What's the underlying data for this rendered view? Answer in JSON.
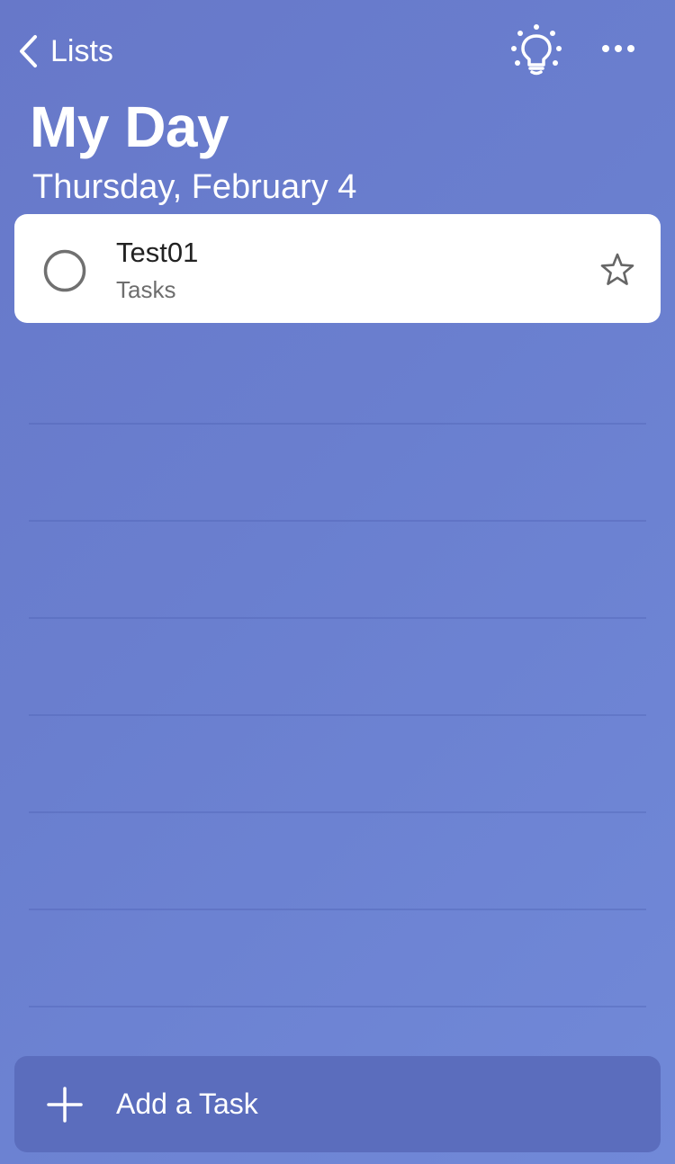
{
  "header": {
    "back_label": "Lists",
    "title": "My Day",
    "date": "Thursday, February 4"
  },
  "icons": {
    "back": "chevron-left-icon",
    "suggestions": "lightbulb-icon",
    "more": "more-horizontal-icon",
    "complete": "circle-icon",
    "importance": "star-icon",
    "add": "plus-icon"
  },
  "tasks": [
    {
      "title": "Test01",
      "list": "Tasks",
      "completed": false,
      "important": false
    }
  ],
  "add_task": {
    "label": "Add a Task"
  },
  "colors": {
    "background_start": "#6778c9",
    "background_end": "#7189d8",
    "card": "#ffffff",
    "add_bar": "#5b6dbd"
  }
}
